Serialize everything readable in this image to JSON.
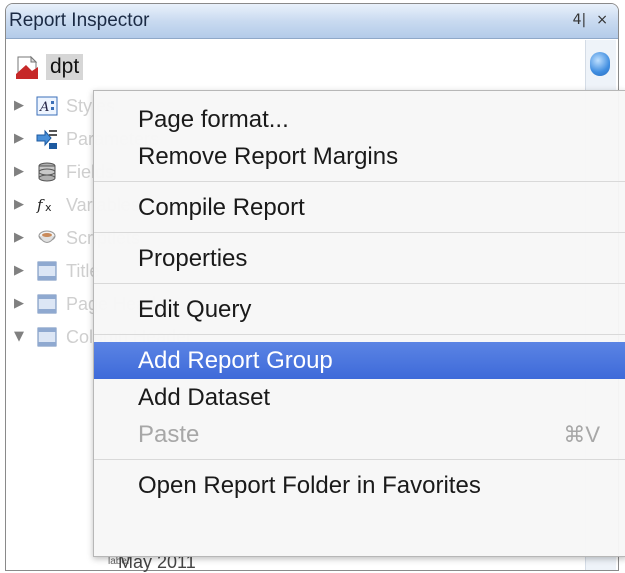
{
  "panel": {
    "title": "Report Inspector",
    "controls": {
      "pin": "4|",
      "close": "×"
    }
  },
  "tree": {
    "root_label": "dpt",
    "rows": [
      {
        "icon": "styles-icon",
        "expanded": false,
        "text": "Styles"
      },
      {
        "icon": "parameters-icon",
        "expanded": false,
        "text": "Parameters"
      },
      {
        "icon": "fields-icon",
        "expanded": false,
        "text": "Fields"
      },
      {
        "icon": "variables-icon",
        "expanded": false,
        "text": "Variables"
      },
      {
        "icon": "scriptlets-icon",
        "expanded": false,
        "text": "Scriptlets"
      },
      {
        "icon": "band-icon",
        "expanded": false,
        "text": "Title"
      },
      {
        "icon": "band-icon",
        "expanded": false,
        "text": "Page Header"
      },
      {
        "icon": "band-icon",
        "expanded": true,
        "text": "Column Header"
      }
    ],
    "below_menu_prefix": "label",
    "below_menu_text": "May 2011"
  },
  "context_menu": {
    "groups": [
      [
        {
          "label": "Page format...",
          "enabled": true
        },
        {
          "label": "Remove Report Margins",
          "enabled": true
        }
      ],
      [
        {
          "label": "Compile Report",
          "enabled": true
        }
      ],
      [
        {
          "label": "Properties",
          "enabled": true
        }
      ],
      [
        {
          "label": "Edit Query",
          "enabled": true
        }
      ],
      [
        {
          "label": "Add Report Group",
          "enabled": true,
          "selected": true
        },
        {
          "label": "Add Dataset",
          "enabled": true
        },
        {
          "label": "Paste",
          "enabled": false,
          "shortcut": "⌘V"
        }
      ],
      [
        {
          "label": "Open Report Folder in Favorites",
          "enabled": true
        }
      ]
    ]
  },
  "colors": {
    "selection": "#4a74de",
    "titlebar": "#c9daf0",
    "disabled_text": "#a7a7a7"
  }
}
